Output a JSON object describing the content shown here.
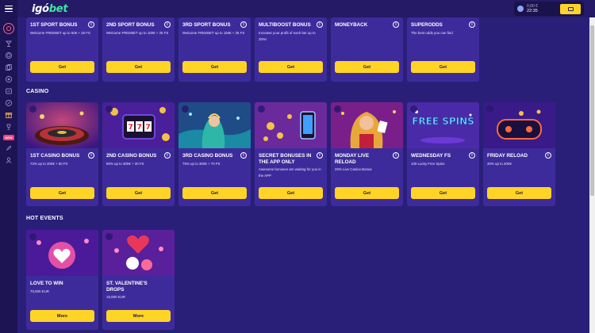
{
  "header": {
    "logo_part1": "igó",
    "logo_part2": "bet",
    "balance": "0,00 €",
    "time": "22:35"
  },
  "sidebar": {
    "icons": [
      "casino-chip-icon",
      "cocktail-icon",
      "sports-ball-icon",
      "cards-icon",
      "poker-chip-icon",
      "lottery-icon",
      "promotions-icon",
      "gift-icon",
      "trophy-icon",
      "tournaments-icon",
      "rocket-icon",
      "user-icon"
    ],
    "new_badge": "NEW"
  },
  "sport_bonuses": [
    {
      "title": "1ST SPORT BONUS",
      "desc": "Welcome FREEBET up to 50€ + 25 FS",
      "button": "Get"
    },
    {
      "title": "2ND SPORT BONUS",
      "desc": "Welcome FREEBET up to 100€ + 25 FS",
      "button": "Get"
    },
    {
      "title": "3RD SPORT BONUS",
      "desc": "Welcome FREEBET up to 150€ + 25 FS",
      "button": "Get"
    },
    {
      "title": "MULTIBOOST BONUS",
      "desc": "Increase your profit of each bet up to 30%!",
      "button": "Get"
    },
    {
      "title": "MONEYBACK",
      "desc": "",
      "button": "Get"
    },
    {
      "title": "SUPERODDS",
      "desc": "The best odds you can find",
      "button": "Get"
    }
  ],
  "casino": {
    "title": "CASINO",
    "cards": [
      {
        "title": "1ST CASINO BONUS",
        "desc": "72% up to 200€ + 50 FS",
        "button": "Get"
      },
      {
        "title": "2ND CASINO BONUS",
        "desc": "50% up to 300€ + 30 FS",
        "button": "Get"
      },
      {
        "title": "3RD CASINO BONUS",
        "desc": "75% up to 300€ + 70 FS",
        "button": "Get"
      },
      {
        "title": "SECRET BONUSES IN THE APP ONLY",
        "desc": "Awesome bonuses are waiting for you in the APP",
        "button": "Get"
      },
      {
        "title": "MONDAY LIVE RELOAD",
        "desc": "25% Live Casino Bonus",
        "button": "Get"
      },
      {
        "title": "WEDNESDAY FS",
        "desc": "100 Lucky Free Spins",
        "button": "Get"
      },
      {
        "title": "FRIDAY RELOAD",
        "desc": "30% up to 200€",
        "button": "Get"
      }
    ]
  },
  "hot_events": {
    "title": "HOT EVENTS",
    "cards": [
      {
        "title": "LOVE TO WIN",
        "desc": "70,000 EUR",
        "button": "More"
      },
      {
        "title": "ST. VALENTINE'S DROPS",
        "desc": "15,000 EUR",
        "button": "More"
      }
    ]
  },
  "free_spins_art_text": "FREE SPINS",
  "colors": {
    "background": "#2a1f78",
    "card": "#3e2b9b",
    "button": "#ffd426",
    "accent_green": "#3ee6a1",
    "accent_pink": "#ff5a86"
  }
}
